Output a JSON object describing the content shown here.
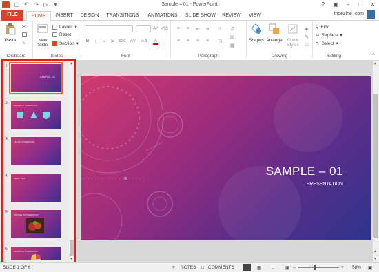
{
  "window": {
    "title": "Sample – 01 - PowerPoint",
    "user": "Indezine .com"
  },
  "tabs": [
    "FILE",
    "HOME",
    "INSERT",
    "DESIGN",
    "TRANSITIONS",
    "ANIMATIONS",
    "SLIDE SHOW",
    "REVIEW",
    "VIEW"
  ],
  "active_tab": "HOME",
  "ribbon": {
    "clipboard": {
      "paste": "Paste",
      "group": "Clipboard"
    },
    "slides": {
      "new_slide_line1": "New",
      "new_slide_line2": "Slide",
      "layout": "Layout",
      "reset": "Reset",
      "section": "Section",
      "group": "Slides"
    },
    "font": {
      "bold": "B",
      "italic": "I",
      "underline": "U",
      "shadow": "S",
      "strike": "abc",
      "spacing": "AV",
      "case": "Aa",
      "color": "A",
      "group": "Font"
    },
    "paragraph": {
      "group": "Paragraph"
    },
    "drawing": {
      "shapes": "Shapes",
      "arrange": "Arrange",
      "quick_styles_line1": "Quick",
      "quick_styles_line2": "Styles",
      "group": "Drawing"
    },
    "editing": {
      "find": "Find",
      "replace": "Replace",
      "select": "Select",
      "group": "Editing"
    }
  },
  "thumbnails": [
    {
      "number": "1",
      "text": "SAMPLE – 01"
    },
    {
      "number": "2",
      "text": "SHAPES IN POWERPOINT"
    },
    {
      "number": "3",
      "text": "TEXT IN POWERPOINT"
    },
    {
      "number": "4",
      "text": "SMART TEXT"
    },
    {
      "number": "5",
      "text": "PICTURE IN POWERPOINT"
    },
    {
      "number": "6",
      "text": "CHARTS IN POWERPOINT"
    }
  ],
  "slide": {
    "title": "SAMPLE – 01",
    "subtitle": "PRESENTATION"
  },
  "status": {
    "slide_info": "SLIDE 1 OF 6",
    "notes": "NOTES",
    "comments": "COMMENTS",
    "zoom": "58%"
  },
  "colors": {
    "accent": "#d24726",
    "selection_border": "#e02020"
  }
}
